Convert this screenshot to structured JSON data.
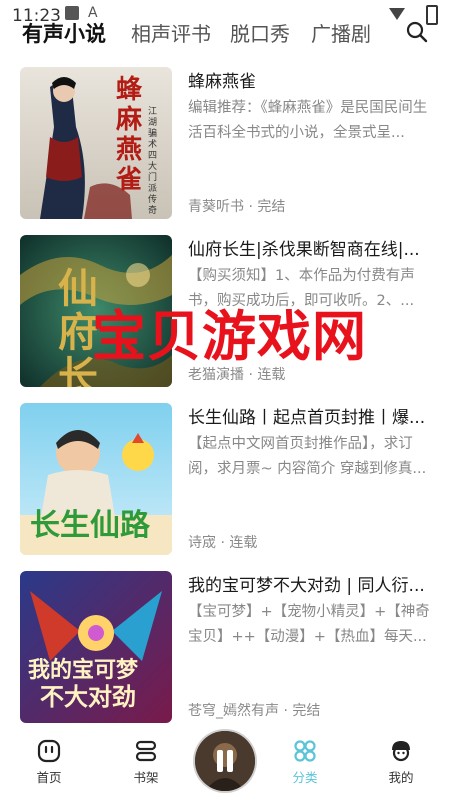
{
  "status": {
    "time": "11:23",
    "letter": "A"
  },
  "nav": {
    "tabs": [
      {
        "label": "有声小说",
        "active": true
      },
      {
        "label": "相声评书",
        "active": false
      },
      {
        "label": "脱口秀",
        "active": false
      },
      {
        "label": "广播剧",
        "active": false
      }
    ]
  },
  "books": [
    {
      "title": "蜂麻燕雀",
      "desc": "编辑推荐：《蜂麻燕雀》是民国民间生活百科全书式的小说，全景式呈...",
      "meta": "青葵听书 · 完结",
      "cover_title": "蜂麻燕雀",
      "cover_sub": "江湖骗术四大门派传奇"
    },
    {
      "title": "仙府长生|杀伐果断智商在线|...",
      "desc": "【购买须知】1、本作品为付费有声书，购买成功后，即可收听。2、...",
      "meta": "老猫演播 · 连载",
      "cover_title": "仙府长生"
    },
    {
      "title": "长生仙路丨起点首页封推丨爆...",
      "desc": "【起点中文网首页封推作品】，求订阅，求月票~ 内容简介 穿越到修真...",
      "meta": "诗宬 · 连载",
      "cover_title": "长生仙路"
    },
    {
      "title": "我的宝可梦不大对劲 | 同人衍...",
      "desc": "【宝可梦】+【宠物小精灵】+【神奇宝贝】++【动漫】+【热血】每天...",
      "meta": "苍穹_嫣然有声 · 完结",
      "cover_title": "我的宝可梦",
      "cover_title2": "不大对劲"
    }
  ],
  "watermark": "宝贝游戏网",
  "bottom_nav": {
    "home": "首页",
    "shelf": "书架",
    "category": "分类",
    "mine": "我的"
  },
  "colors": {
    "accent": "#5cc4d8",
    "watermark": "#e8121c"
  }
}
